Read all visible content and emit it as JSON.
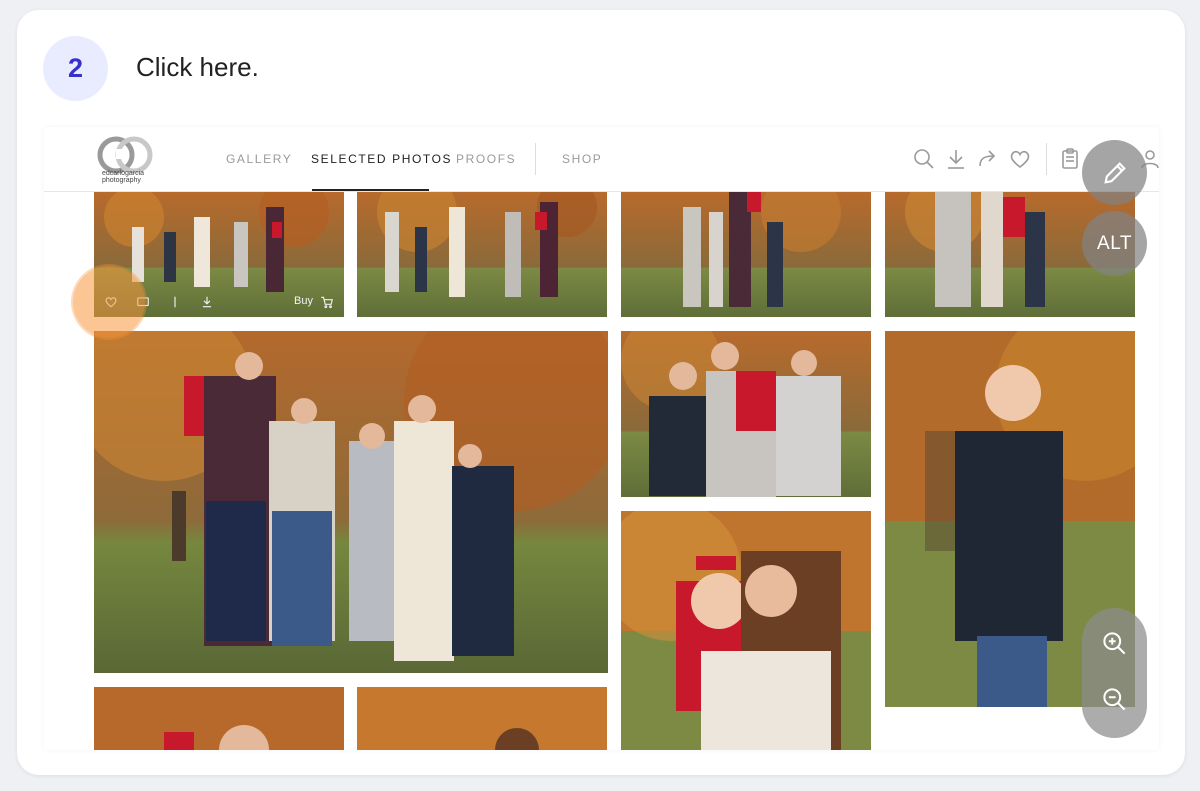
{
  "step": {
    "number": "2",
    "instruction": "Click here."
  },
  "logo": {
    "line1": "edcarlogarcia",
    "line2": "photography"
  },
  "nav": {
    "items": [
      "GALLERY",
      "SELECTED PHOTOS",
      "PROOFS",
      "SHOP"
    ],
    "active": "SELECTED PHOTOS"
  },
  "toolbar_icons": [
    "search-icon",
    "download-icon",
    "share-icon",
    "heart-icon",
    "clipboard-icon",
    "user-icon"
  ],
  "photo_hover": {
    "buy_label": "Buy"
  },
  "floating": {
    "alt_label": "ALT"
  },
  "colors": {
    "accent": "#3730c9",
    "badge_bg": "#e9ebff",
    "highlight": "#f7963c"
  }
}
